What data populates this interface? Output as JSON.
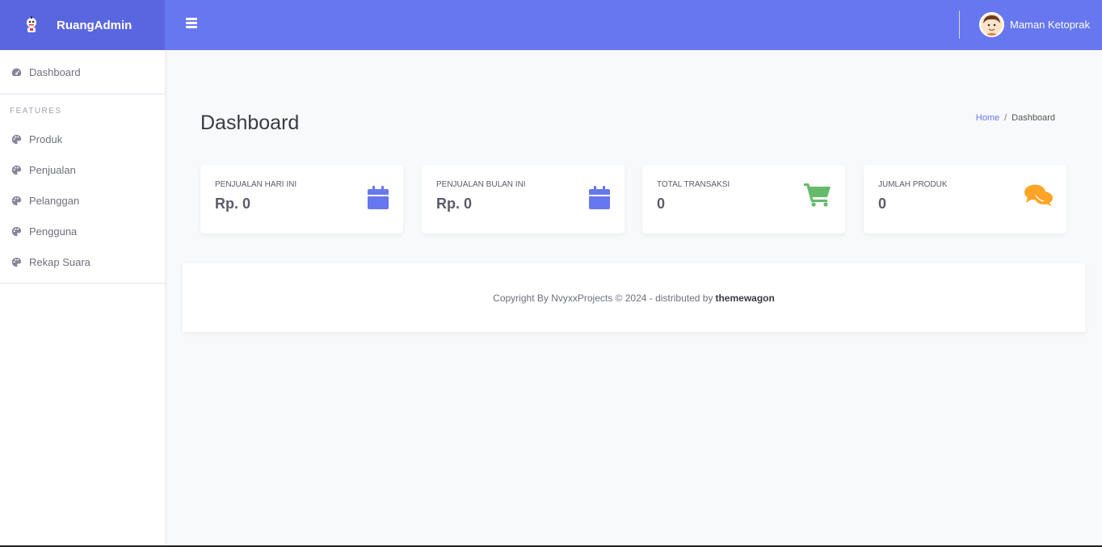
{
  "brand": {
    "name": "RuangAdmin",
    "logo_icon": "robot-icon"
  },
  "sidebar": {
    "top_item": {
      "label": "Dashboard",
      "icon": "dashboard-gauge-icon"
    },
    "heading": "FEATURES",
    "items": [
      {
        "label": "Produk",
        "icon": "palette-icon"
      },
      {
        "label": "Penjualan",
        "icon": "palette-icon"
      },
      {
        "label": "Pelanggan",
        "icon": "palette-icon"
      },
      {
        "label": "Pengguna",
        "icon": "palette-icon"
      },
      {
        "label": "Rekap Suara",
        "icon": "palette-icon"
      }
    ]
  },
  "topbar": {
    "menu_icon": "hamburger-icon",
    "user_name": "Maman Ketoprak"
  },
  "page": {
    "title": "Dashboard",
    "breadcrumb": {
      "home": "Home",
      "separator": "/",
      "current": "Dashboard"
    }
  },
  "cards": [
    {
      "label": "PENJUALAN HARI INI",
      "value": "Rp. 0",
      "icon": "calendar-icon",
      "color": "#6777ef"
    },
    {
      "label": "PENJUALAN BULAN INI",
      "value": "Rp. 0",
      "icon": "calendar-icon",
      "color": "#6777ef"
    },
    {
      "label": "TOTAL TRANSAKSI",
      "value": "0",
      "icon": "shopping-cart-icon",
      "color": "#66bb6a"
    },
    {
      "label": "JUMLAH PRODUK",
      "value": "0",
      "icon": "comments-icon",
      "color": "#ffa426"
    }
  ],
  "footer": {
    "text": "Copyright By NvyxxProjects © 2024 - distributed by",
    "link": "themewagon"
  },
  "colors": {
    "primary": "#6777ef",
    "brand_bg": "#5a66e0",
    "success": "#66bb6a",
    "warning": "#ffa426"
  }
}
